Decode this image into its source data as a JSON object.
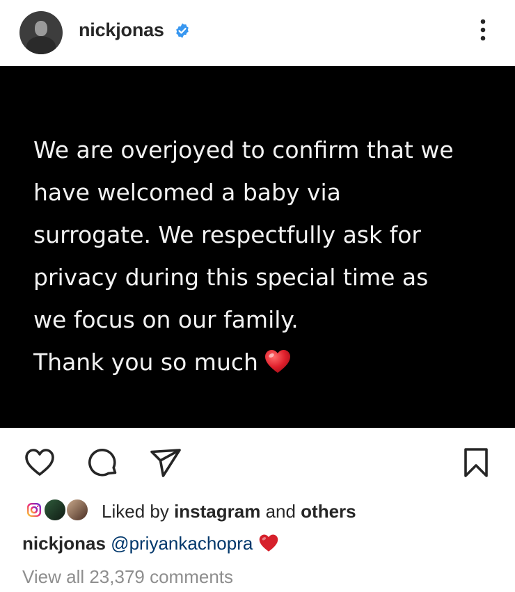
{
  "header": {
    "username": "nickjonas",
    "verified_icon": "verified-badge-icon",
    "more_icon": "more-options-icon"
  },
  "post": {
    "lines": [
      "We are overjoyed to confirm that we",
      "have welcomed a baby via",
      "surrogate. We respectfully ask for",
      "privacy during this special time as",
      "we focus on our family.",
      "Thank you so much"
    ],
    "heart_icon": "red-heart-emoji-icon"
  },
  "actions": {
    "like_icon": "heart-outline-icon",
    "comment_icon": "comment-bubble-icon",
    "share_icon": "paper-plane-icon",
    "save_icon": "bookmark-icon"
  },
  "likes": {
    "prefix": "Liked by ",
    "user": "instagram",
    "middle": " and ",
    "others": "others"
  },
  "caption": {
    "username": "nickjonas",
    "mention": "@priyankachopra"
  },
  "comments": {
    "view_all": "View all 23,379 comments"
  },
  "colors": {
    "verified": "#3897f0",
    "heart": "#e0202c",
    "mention": "#00376b",
    "muted": "#8e8e8e"
  }
}
